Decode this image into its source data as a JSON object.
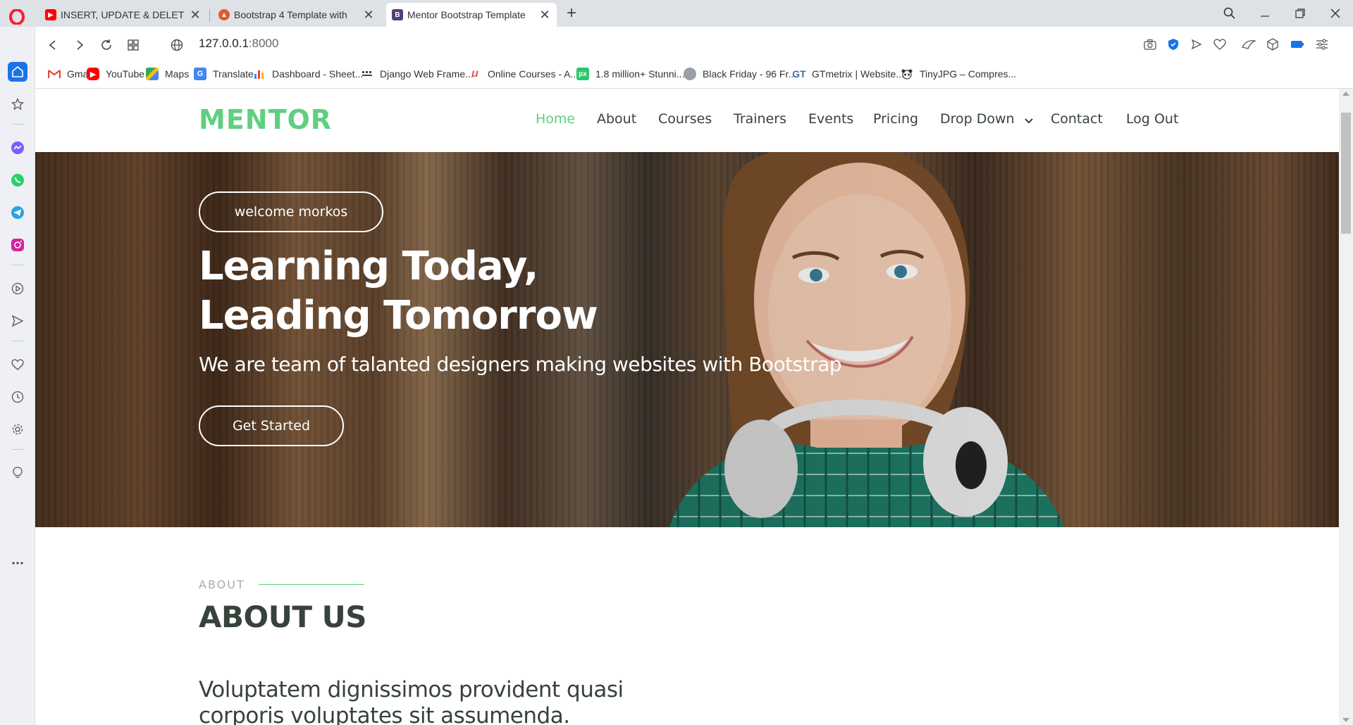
{
  "browser": {
    "tabs": [
      {
        "title": "INSERT, UPDATE & DELETE",
        "favicon": "youtube-icon",
        "color": "#ff0000"
      },
      {
        "title": "Bootstrap 4 Template with",
        "favicon": "bootstrap-template-icon",
        "color": "#e4572e"
      },
      {
        "title": "Mentor Bootstrap Template",
        "favicon": "bootstrap-icon",
        "color": "#563d7c"
      }
    ],
    "url_host": "127.0.0.1",
    "url_port": ":8000",
    "bookmarks": [
      {
        "label": "Gmail",
        "icon": "gmail-icon"
      },
      {
        "label": "YouTube",
        "icon": "youtube-icon"
      },
      {
        "label": "Maps",
        "icon": "maps-icon"
      },
      {
        "label": "Translate",
        "icon": "translate-icon"
      },
      {
        "label": "Dashboard - Sheet...",
        "icon": "sheets-chart-icon"
      },
      {
        "label": "Django Web Frame...",
        "icon": "django-icon"
      },
      {
        "label": "Online Courses - A...",
        "icon": "udemy-icon"
      },
      {
        "label": "1.8 million+ Stunni...",
        "icon": "pixabay-icon"
      },
      {
        "label": "Black Friday - 96 Fr...",
        "icon": "globe-icon"
      },
      {
        "label": "GTmetrix | Website...",
        "icon": "gtmetrix-icon"
      },
      {
        "label": "TinyJPG – Compres...",
        "icon": "panda-icon"
      }
    ]
  },
  "site": {
    "logo": "MENTOR",
    "accent_color": "#5fcf80",
    "nav": [
      {
        "label": "Home",
        "active": true
      },
      {
        "label": "About"
      },
      {
        "label": "Courses"
      },
      {
        "label": "Trainers"
      },
      {
        "label": "Events"
      },
      {
        "label": "Pricing"
      },
      {
        "label": "Drop Down",
        "has_dropdown": true
      },
      {
        "label": "Contact"
      },
      {
        "label": "Log Out"
      }
    ],
    "hero": {
      "welcome": "welcome morkos",
      "title_line1": "Learning Today,",
      "title_line2": "Leading Tomorrow",
      "subtitle": "We are team of talanted designers making websites with Bootstrap",
      "cta": "Get Started"
    },
    "about": {
      "label": "ABOUT",
      "title": "ABOUT US",
      "lead": "Voluptatem dignissimos provident quasi corporis voluptates sit assumenda."
    }
  }
}
